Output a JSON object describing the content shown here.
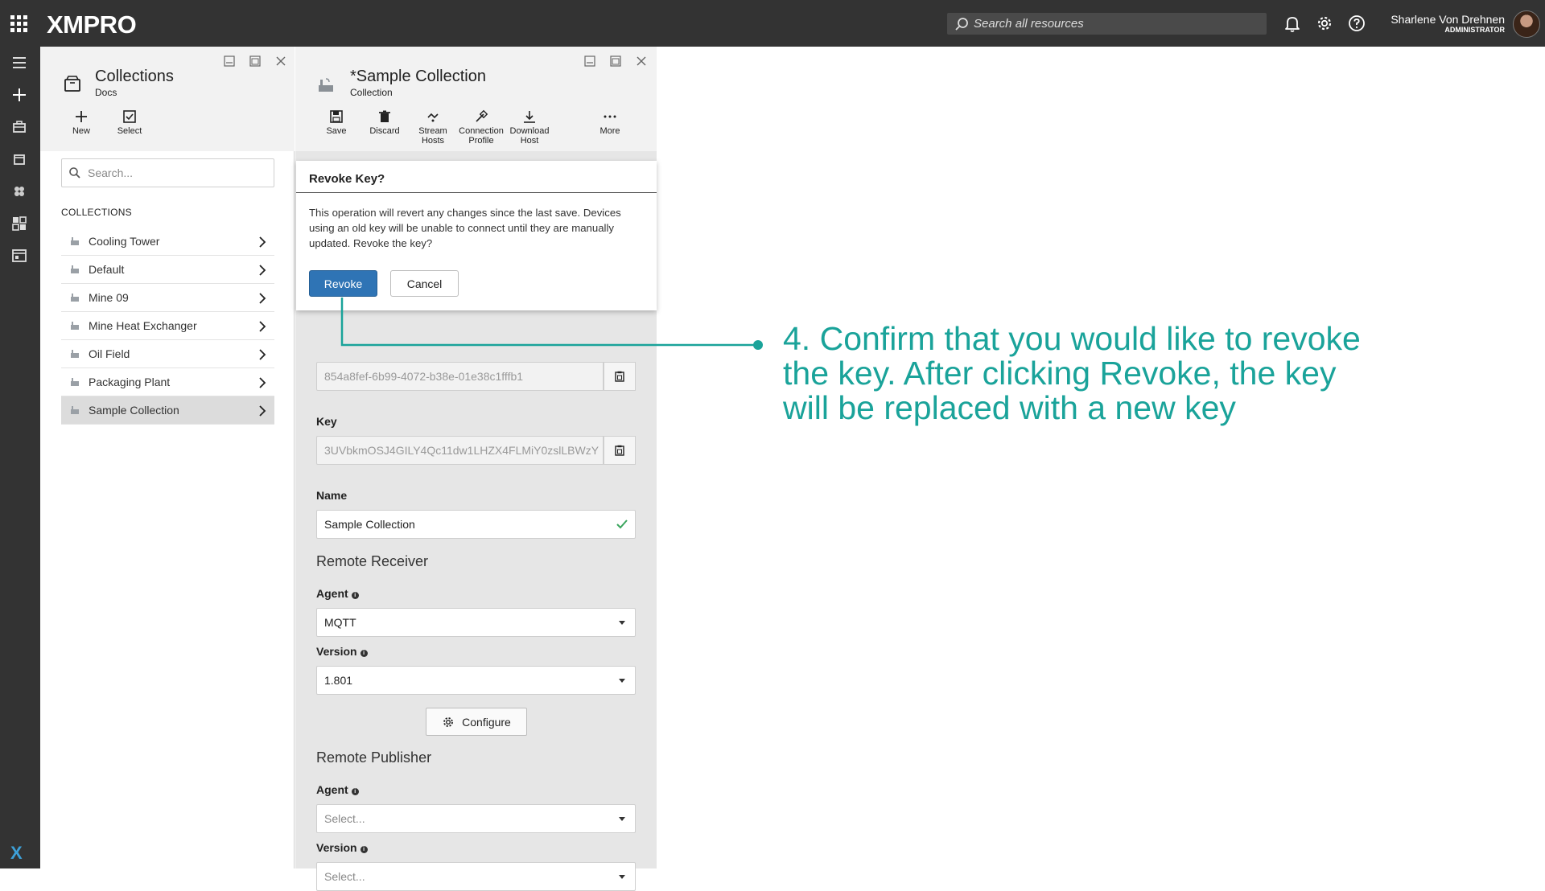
{
  "topbar": {
    "logo": "XMPRO",
    "search_placeholder": "Search all resources",
    "user_name": "Sharlene Von Drehnen",
    "user_role": "ADMINISTRATOR"
  },
  "collections_panel": {
    "title": "Collections",
    "subtitle": "Docs",
    "toolbar": {
      "new": "New",
      "select": "Select"
    },
    "search_placeholder": "Search...",
    "section_label": "COLLECTIONS",
    "items": [
      {
        "label": "Cooling Tower"
      },
      {
        "label": "Default"
      },
      {
        "label": "Mine 09"
      },
      {
        "label": "Mine Heat Exchanger"
      },
      {
        "label": "Oil Field"
      },
      {
        "label": "Packaging Plant"
      },
      {
        "label": "Sample Collection",
        "selected": true
      }
    ]
  },
  "sample_panel": {
    "title": "*Sample Collection",
    "subtitle": "Collection",
    "toolbar": {
      "save": "Save",
      "discard": "Discard",
      "stream_hosts_1": "Stream",
      "stream_hosts_2": "Hosts",
      "connection_profile_1": "Connection",
      "connection_profile_2": "Profile",
      "download_host_1": "Download",
      "download_host_2": "Host",
      "more": "More"
    },
    "id_value": "854a8fef-6b99-4072-b38e-01e38c1fffb1",
    "key_label": "Key",
    "key_value": "3UVbkmOSJ4GILY4Qc11dw1LHZX4FLMiY0zslLBWzY",
    "name_label": "Name",
    "name_value": "Sample Collection",
    "remote_receiver": {
      "title": "Remote Receiver",
      "agent_label": "Agent",
      "agent_value": "MQTT",
      "version_label": "Version",
      "version_value": "1.801",
      "configure": "Configure"
    },
    "remote_publisher": {
      "title": "Remote Publisher",
      "agent_label": "Agent",
      "agent_placeholder": "Select...",
      "version_label": "Version",
      "version_placeholder": "Select..."
    }
  },
  "modal": {
    "title": "Revoke Key?",
    "message": "This operation will revert any changes since the last save. Devices using an old key will be unable to connect until they are manually updated. Revoke the key?",
    "revoke": "Revoke",
    "cancel": "Cancel"
  },
  "annotation": {
    "text": "4. Confirm that you would like to revoke the key. After clicking Revoke, the key will be replaced with a new key",
    "color": "#1aa39a"
  },
  "colors": {
    "topbar": "#333333",
    "primary_button": "#2f74b5",
    "accent_text": "#1aa39a",
    "valid_check": "#3aa55d"
  }
}
